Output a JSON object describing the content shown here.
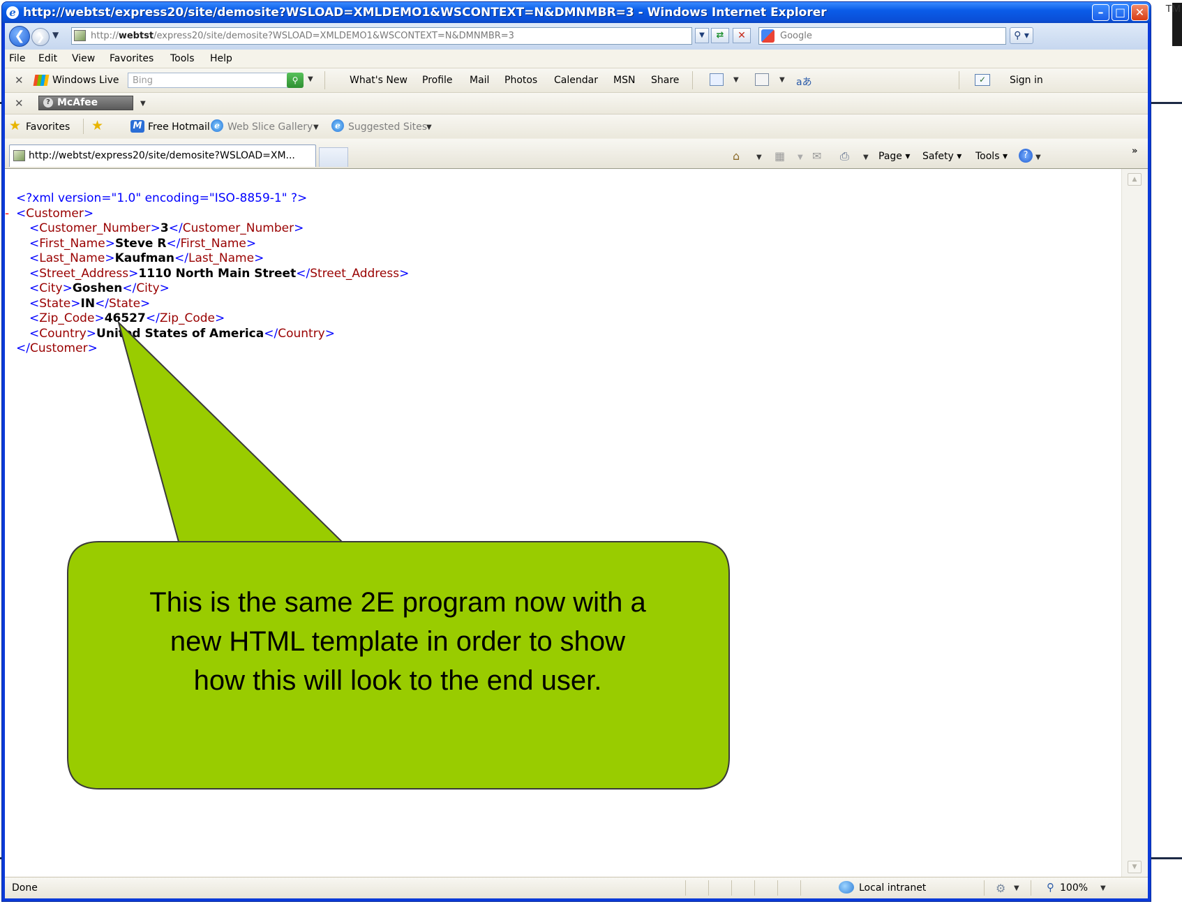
{
  "slide": {
    "tm": "TM"
  },
  "window": {
    "title": "http://webtst/express20/site/demosite?WSLOAD=XMLDEMO1&WSCONTEXT=N&DMNMBR=3 - Windows Internet Explorer",
    "btn_min": "–",
    "btn_max": "□",
    "btn_close": "✕"
  },
  "address": {
    "prefix": "http://",
    "host": "webtst",
    "path": "/express20/site/demosite?WSLOAD=XMLDEMO1&WSCONTEXT=N&DMNMBR=3",
    "search_placeholder": "Google"
  },
  "menu": [
    "File",
    "Edit",
    "View",
    "Favorites",
    "Tools",
    "Help"
  ],
  "windows_live": {
    "label": "Windows Live",
    "bing_placeholder": "Bing",
    "links": [
      "What's New",
      "Profile",
      "Mail",
      "Photos",
      "Calendar",
      "MSN",
      "Share"
    ],
    "sign_in": "Sign in"
  },
  "mcafee": {
    "label": "McAfee"
  },
  "favorites": {
    "label": "Favorites",
    "hotmail": "Free Hotmail",
    "web_slice": "Web Slice Gallery",
    "suggested": "Suggested Sites"
  },
  "tab": {
    "title": "http://webtst/express20/site/demosite?WSLOAD=XM..."
  },
  "commands": {
    "page": "Page",
    "safety": "Safety",
    "tools": "Tools"
  },
  "xml": {
    "declaration": "<?xml version=\"1.0\" encoding=\"ISO-8859-1\" ?>",
    "collapse": "-",
    "root": "Customer",
    "fields": [
      {
        "tag": "Customer_Number",
        "value": "3"
      },
      {
        "tag": "First_Name",
        "value": "Steve R"
      },
      {
        "tag": "Last_Name",
        "value": "Kaufman"
      },
      {
        "tag": "Street_Address",
        "value": "1110 North Main Street"
      },
      {
        "tag": "City",
        "value": "Goshen"
      },
      {
        "tag": "State",
        "value": "IN"
      },
      {
        "tag": "Zip_Code",
        "value": "46527"
      },
      {
        "tag": "Country",
        "value": "United States of America"
      }
    ]
  },
  "status": {
    "text": "Done",
    "zone": "Local intranet",
    "zoom": "100%"
  },
  "callout": {
    "line1": "This is the same 2E program now with a",
    "line2": "new HTML template in order to show",
    "line3": "how this will look to the end user.",
    "fill_color": "#99cc00",
    "stroke_color": "#3a3a3a"
  }
}
